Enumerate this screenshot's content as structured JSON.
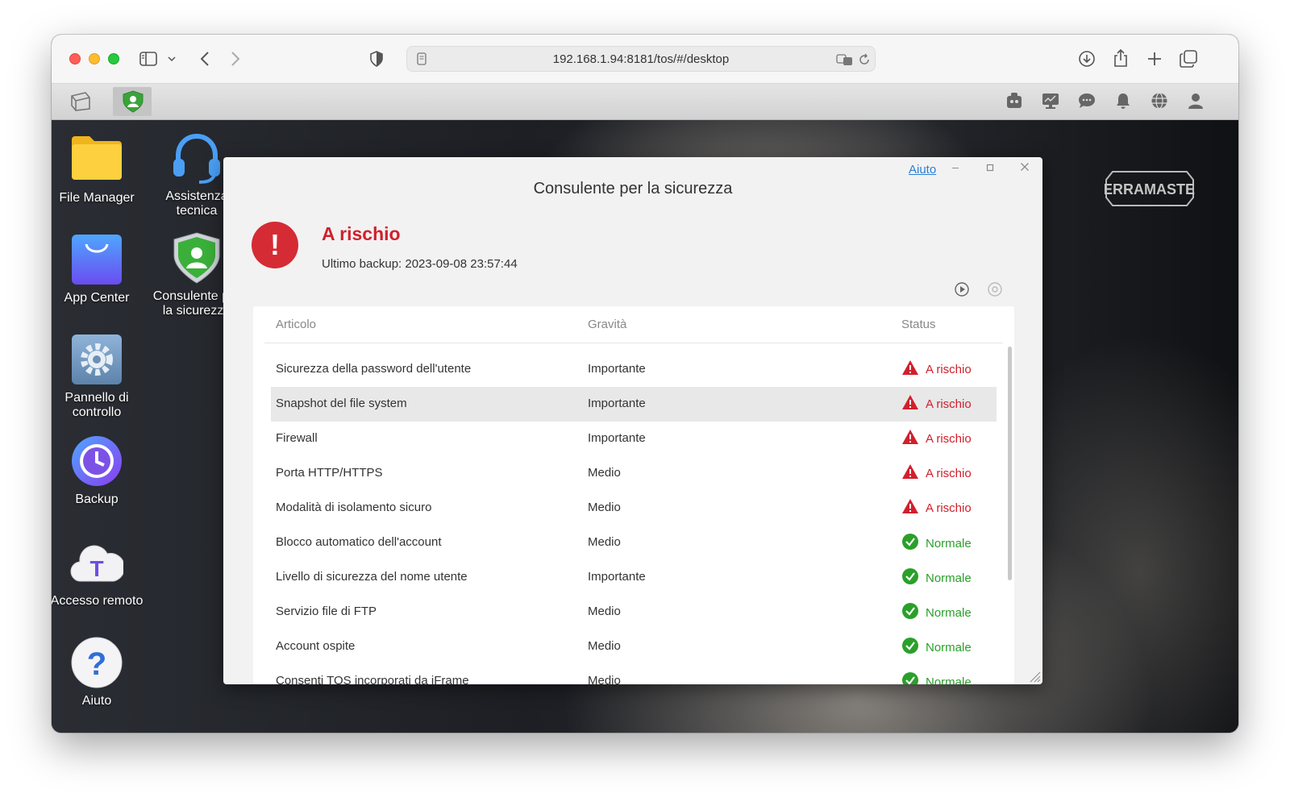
{
  "browser": {
    "url": "192.168.1.94:8181/tos/#/desktop"
  },
  "desktop_icons": [
    {
      "label": "File Manager"
    },
    {
      "label": "Assistenza tecnica"
    },
    {
      "label": "App Center"
    },
    {
      "label": "Consulente per la sicurezza"
    },
    {
      "label": "Pannello di controllo"
    },
    {
      "label": "Backup"
    },
    {
      "label": "Accesso remoto"
    },
    {
      "label": "Aiuto"
    }
  ],
  "brand": "TERRAMASTER",
  "dialog": {
    "title": "Consulente per la sicurezza",
    "help_link": "Aiuto",
    "status_title": "A rischio",
    "last_backup": "Ultimo backup: 2023-09-08 23:57:44",
    "columns": [
      "Articolo",
      "Gravità",
      "Status"
    ],
    "rows": [
      {
        "item": "Sicurezza della password dell'utente",
        "severity": "Importante",
        "status": "A rischio",
        "state": "risk"
      },
      {
        "item": "Snapshot del file system",
        "severity": "Importante",
        "status": "A rischio",
        "state": "risk"
      },
      {
        "item": "Firewall",
        "severity": "Importante",
        "status": "A rischio",
        "state": "risk"
      },
      {
        "item": "Porta HTTP/HTTPS",
        "severity": "Medio",
        "status": "A rischio",
        "state": "risk"
      },
      {
        "item": "Modalità di isolamento sicuro",
        "severity": "Medio",
        "status": "A rischio",
        "state": "risk"
      },
      {
        "item": "Blocco automatico dell'account",
        "severity": "Medio",
        "status": "Normale",
        "state": "ok"
      },
      {
        "item": "Livello di sicurezza del nome utente",
        "severity": "Importante",
        "status": "Normale",
        "state": "ok"
      },
      {
        "item": "Servizio file di FTP",
        "severity": "Medio",
        "status": "Normale",
        "state": "ok"
      },
      {
        "item": "Account ospite",
        "severity": "Medio",
        "status": "Normale",
        "state": "ok"
      },
      {
        "item": "Consenti TOS incorporati da iFrame",
        "severity": "Medio",
        "status": "Normale",
        "state": "ok"
      }
    ]
  },
  "colors": {
    "risk": "#d1202c",
    "ok": "#2aa02a",
    "link": "#2b7fd6"
  }
}
